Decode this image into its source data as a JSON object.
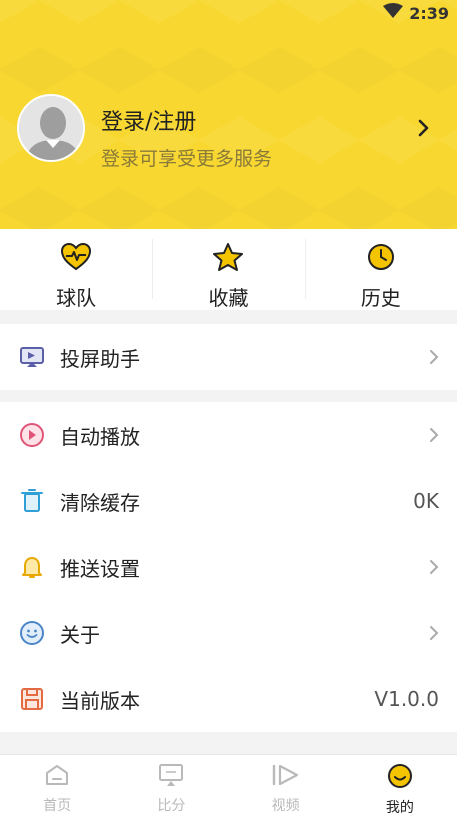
{
  "status": {
    "time": "2:39",
    "wifi_icon": "wifi-icon"
  },
  "profile": {
    "title": "登录/注册",
    "subtitle": "登录可享受更多服务"
  },
  "quick_actions": [
    {
      "label": "球队",
      "icon": "heart-pulse-icon"
    },
    {
      "label": "收藏",
      "icon": "star-icon"
    },
    {
      "label": "历史",
      "icon": "clock-icon"
    }
  ],
  "menu_group_1": [
    {
      "label": "投屏助手",
      "icon": "screen-cast-icon",
      "value": ""
    }
  ],
  "menu_group_2": [
    {
      "label": "自动播放",
      "icon": "play-circle-icon",
      "value": ""
    },
    {
      "label": "清除缓存",
      "icon": "trash-icon",
      "value": "0K"
    },
    {
      "label": "推送设置",
      "icon": "bell-icon",
      "value": ""
    },
    {
      "label": "关于",
      "icon": "smiley-icon",
      "value": ""
    },
    {
      "label": "当前版本",
      "icon": "save-icon",
      "value": "V1.0.0"
    }
  ],
  "tabs": [
    {
      "label": "首页",
      "icon": "home-icon",
      "active": false
    },
    {
      "label": "比分",
      "icon": "scoreboard-icon",
      "active": false
    },
    {
      "label": "视频",
      "icon": "video-icon",
      "active": false
    },
    {
      "label": "我的",
      "icon": "profile-face-icon",
      "active": true
    }
  ],
  "colors": {
    "brand_yellow": "#f8d830",
    "accent": "#f5c400"
  }
}
